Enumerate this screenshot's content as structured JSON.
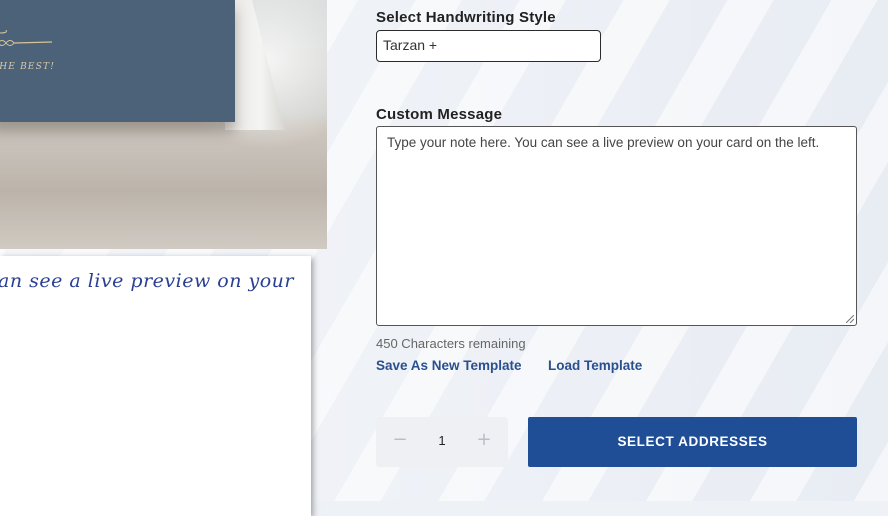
{
  "product": {
    "card_front_text": "THE BEST!",
    "preview_handwriting": "an see a live preview on your"
  },
  "form": {
    "handwriting_label": "Select Handwriting Style",
    "handwriting_value": "Tarzan +",
    "message_label": "Custom Message",
    "message_placeholder": "Type your note here. You can see a live preview on your card on the left.",
    "remaining": "450 Characters remaining",
    "save_template": "Save As New Template",
    "load_template": "Load Template"
  },
  "purchase": {
    "minus": "−",
    "quantity": "1",
    "plus": "+",
    "cta": "SELECT ADDRESSES"
  },
  "colors": {
    "card": "#4c6279",
    "accent": "#1f4e97",
    "link": "#2a4f8f",
    "ink": "#2a3f93"
  },
  "icons": {
    "ornament": "flourish-ornament-icon",
    "resize": "resize-grip-icon"
  }
}
